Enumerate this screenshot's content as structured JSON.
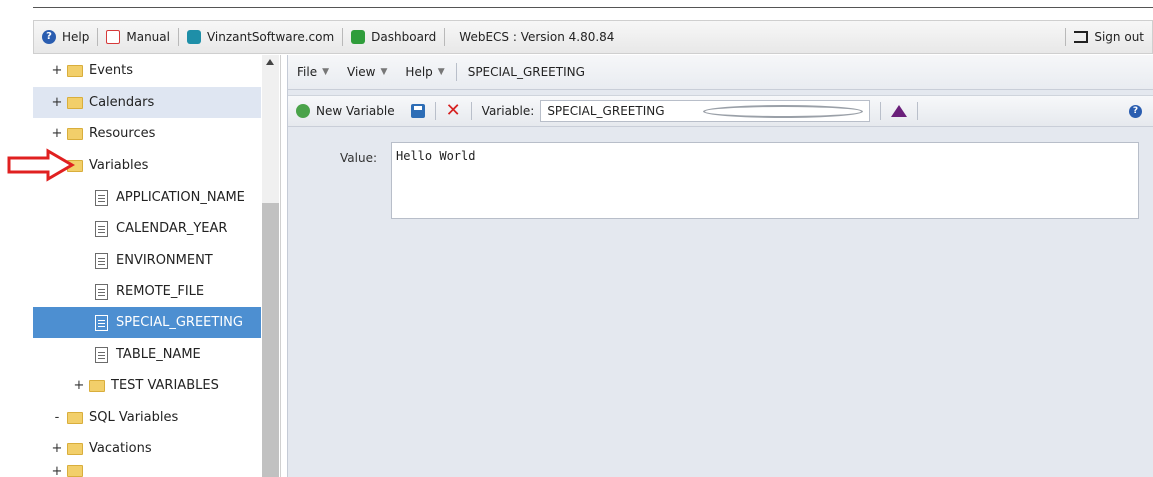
{
  "topbar": {
    "help": "Help",
    "manual": "Manual",
    "vinzant": "VinzantSoftware.com",
    "dashboard": "Dashboard",
    "version": "WebECS : Version 4.80.84",
    "signout": "Sign out"
  },
  "tree": {
    "events": "Events",
    "calendars": "Calendars",
    "resources": "Resources",
    "variables": "Variables",
    "items": [
      "APPLICATION_NAME",
      "CALENDAR_YEAR",
      "ENVIRONMENT",
      "REMOTE_FILE",
      "SPECIAL_GREETING",
      "TABLE_NAME"
    ],
    "test_variables": "TEST VARIABLES",
    "sql_variables": "SQL Variables",
    "vacations": "Vacations",
    "plus": "+",
    "minus": "-"
  },
  "menubar": {
    "file": "File",
    "view": "View",
    "help": "Help",
    "breadcrumb": "SPECIAL_GREETING"
  },
  "toolbar": {
    "new_variable": "New Variable",
    "variable_label": "Variable:",
    "variable_value": "SPECIAL_GREETING"
  },
  "editor": {
    "value_label": "Value:",
    "value_text": "Hello World"
  },
  "colors": {
    "selected": "#4d8fd1",
    "highlight": "#dfe6f2",
    "arrow": "#e02020"
  }
}
